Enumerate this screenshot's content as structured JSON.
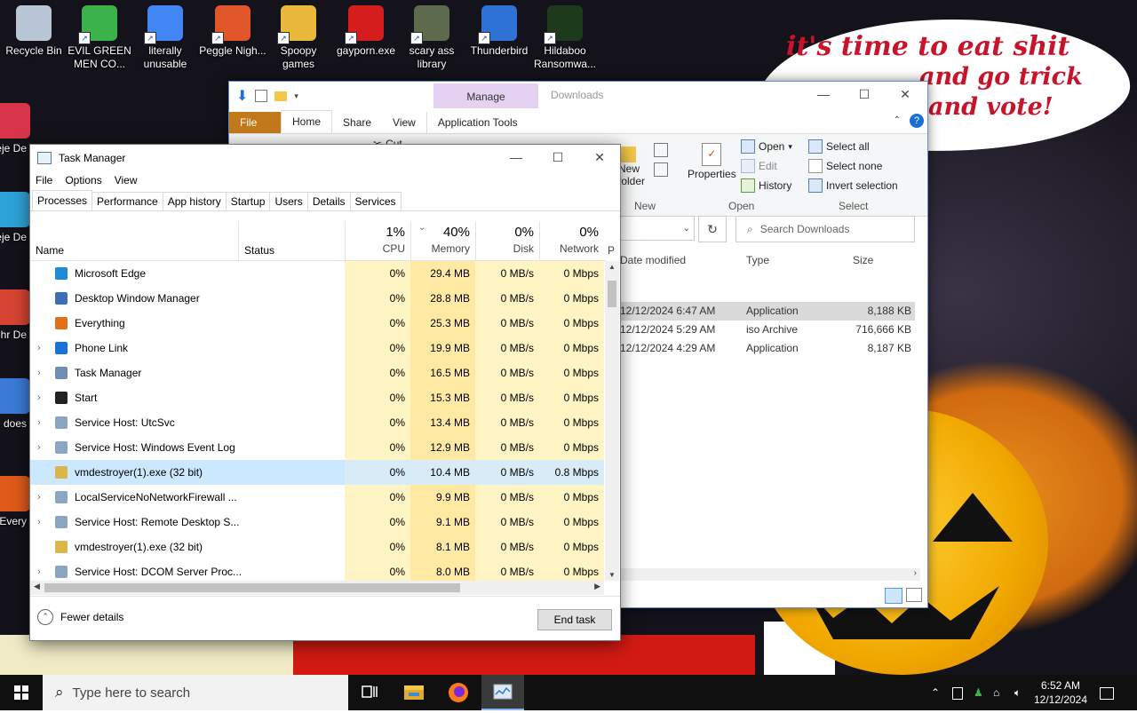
{
  "desktop": {
    "icons": [
      {
        "label": "Recycle Bin",
        "color": "#b8c6d6"
      },
      {
        "label": "EVIL GREEN MEN CO...",
        "color": "#3bb34a"
      },
      {
        "label": "literally unusable",
        "color": "#4285f4"
      },
      {
        "label": "Peggle Nigh...",
        "color": "#e0552a"
      },
      {
        "label": "Spoopy games",
        "color": "#e8b93a"
      },
      {
        "label": "gayporn.exe",
        "color": "#d51d1d"
      },
      {
        "label": "scary ass library",
        "color": "#5d6a4e"
      },
      {
        "label": "Thunderbird",
        "color": "#2f72d6"
      },
      {
        "label": "Hildaboo Ransomwa...",
        "color": "#1d3a1d"
      }
    ],
    "left_icons": [
      {
        "label": "Beje De",
        "color": "#d8354a"
      },
      {
        "label": "Beje De",
        "color": "#2ea3d8"
      },
      {
        "label": "Chr De",
        "color": "#d84433"
      },
      {
        "label": "does",
        "color": "#3b7bd8"
      },
      {
        "label": "Every",
        "color": "#e05a1a"
      }
    ],
    "speech_line1": "it's time to eat shit",
    "speech_line2_partial": "and go trick",
    "speech_line3": "and vote!"
  },
  "explorer": {
    "manage_tab": "Manage",
    "location": "Downloads",
    "tabs": {
      "file": "File",
      "home": "Home",
      "share": "Share",
      "view": "View",
      "app_tools": "Application Tools"
    },
    "ribbon": {
      "cut": "Cut",
      "new_folder": "New folder",
      "new_group": "New",
      "properties": "Properties",
      "open": "Open",
      "edit": "Edit",
      "history": "History",
      "open_group": "Open",
      "select_all": "Select all",
      "select_none": "Select none",
      "invert_selection": "Invert selection",
      "select_group": "Select"
    },
    "search_placeholder": "Search Downloads",
    "columns": {
      "date": "Date modified",
      "type": "Type",
      "size": "Size"
    },
    "rows": [
      {
        "date": "12/12/2024 6:47 AM",
        "type": "Application",
        "size": "8,188 KB"
      },
      {
        "date": "12/12/2024 5:29 AM",
        "type": "iso Archive",
        "size": "716,666 KB"
      },
      {
        "date": "12/12/2024 4:29 AM",
        "type": "Application",
        "size": "8,187 KB"
      }
    ]
  },
  "taskmgr": {
    "title": "Task Manager",
    "menu": {
      "file": "File",
      "options": "Options",
      "view": "View"
    },
    "tabs": [
      "Processes",
      "Performance",
      "App history",
      "Startup",
      "Users",
      "Details",
      "Services"
    ],
    "header": {
      "name": "Name",
      "status": "Status",
      "cpu_pct": "1%",
      "cpu": "CPU",
      "mem_pct": "40%",
      "mem": "Memory",
      "disk_pct": "0%",
      "disk": "Disk",
      "net_pct": "0%",
      "net": "Network",
      "power": "P"
    },
    "processes": [
      {
        "name": "Microsoft Edge",
        "expand": false,
        "cpu": "0%",
        "mem": "29.4 MB",
        "disk": "0 MB/s",
        "net": "0 Mbps",
        "icon": "#1f8ad6"
      },
      {
        "name": "Desktop Window Manager",
        "expand": false,
        "cpu": "0%",
        "mem": "28.8 MB",
        "disk": "0 MB/s",
        "net": "0 Mbps",
        "icon": "#3b6fb8"
      },
      {
        "name": "Everything",
        "expand": false,
        "cpu": "0%",
        "mem": "25.3 MB",
        "disk": "0 MB/s",
        "net": "0 Mbps",
        "icon": "#e0701a"
      },
      {
        "name": "Phone Link",
        "expand": true,
        "cpu": "0%",
        "mem": "19.9 MB",
        "disk": "0 MB/s",
        "net": "0 Mbps",
        "icon": "#1773d6"
      },
      {
        "name": "Task Manager",
        "expand": true,
        "cpu": "0%",
        "mem": "16.5 MB",
        "disk": "0 MB/s",
        "net": "0 Mbps",
        "icon": "#6f8fb0"
      },
      {
        "name": "Start",
        "expand": true,
        "cpu": "0%",
        "mem": "15.3 MB",
        "disk": "0 MB/s",
        "net": "0 Mbps",
        "icon": "#222222"
      },
      {
        "name": "Service Host: UtcSvc",
        "expand": true,
        "cpu": "0%",
        "mem": "13.4 MB",
        "disk": "0 MB/s",
        "net": "0 Mbps",
        "icon": "#8aa6c2"
      },
      {
        "name": "Service Host: Windows Event Log",
        "expand": true,
        "cpu": "0%",
        "mem": "12.9 MB",
        "disk": "0 MB/s",
        "net": "0 Mbps",
        "icon": "#8aa6c2"
      },
      {
        "name": "vmdestroyer(1).exe (32 bit)",
        "expand": false,
        "cpu": "0%",
        "mem": "10.4 MB",
        "disk": "0 MB/s",
        "net": "0.8 Mbps",
        "icon": "#d9b54a",
        "selected": true
      },
      {
        "name": "LocalServiceNoNetworkFirewall ...",
        "expand": true,
        "cpu": "0%",
        "mem": "9.9 MB",
        "disk": "0 MB/s",
        "net": "0 Mbps",
        "icon": "#8aa6c2"
      },
      {
        "name": "Service Host: Remote Desktop S...",
        "expand": true,
        "cpu": "0%",
        "mem": "9.1 MB",
        "disk": "0 MB/s",
        "net": "0 Mbps",
        "icon": "#8aa6c2"
      },
      {
        "name": "vmdestroyer(1).exe (32 bit)",
        "expand": false,
        "cpu": "0%",
        "mem": "8.1 MB",
        "disk": "0 MB/s",
        "net": "0 Mbps",
        "icon": "#d9b54a"
      },
      {
        "name": "Service Host: DCOM Server Proc...",
        "expand": true,
        "cpu": "0%",
        "mem": "8.0 MB",
        "disk": "0 MB/s",
        "net": "0 Mbps",
        "icon": "#8aa6c2"
      }
    ],
    "fewer_details": "Fewer details",
    "end_task": "End task"
  },
  "taskbar": {
    "search_placeholder": "Type here to search",
    "time": "6:52 AM",
    "date": "12/12/2024"
  }
}
